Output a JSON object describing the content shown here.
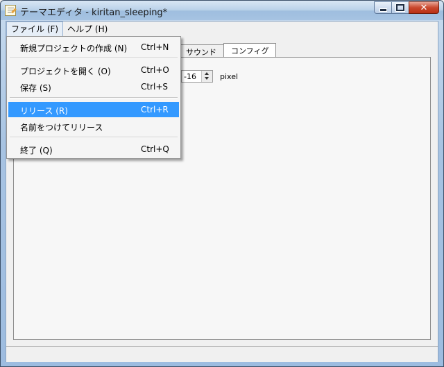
{
  "window": {
    "title": "テーマエディタ - kiritan_sleeping*"
  },
  "caption": {
    "minimize": "minimize",
    "maximize": "maximize",
    "close": "✕"
  },
  "menubar": [
    {
      "label": "ファイル (F)"
    },
    {
      "label": "ヘルプ (H)"
    }
  ],
  "file_menu": {
    "items": [
      {
        "label": "新規プロジェクトの作成 (N)",
        "shortcut": "Ctrl+N"
      },
      {
        "label": "プロジェクトを開く (O)",
        "shortcut": "Ctrl+O"
      },
      {
        "label": "保存 (S)",
        "shortcut": "Ctrl+S"
      },
      {
        "label": "リリース (R)",
        "shortcut": "Ctrl+R"
      },
      {
        "label": "名前をつけてリリース",
        "shortcut": ""
      },
      {
        "label": "終了 (Q)",
        "shortcut": "Ctrl+Q"
      }
    ]
  },
  "tabs": [
    {
      "label": "サウンド"
    },
    {
      "label": "コンフィグ"
    }
  ],
  "config": {
    "offset_value": "-16",
    "unit": "pixel"
  },
  "colors": {
    "highlight": "#3399ff",
    "title_gradient": "#a6c3e2"
  },
  "icons": {
    "app": "notepad-icon"
  }
}
